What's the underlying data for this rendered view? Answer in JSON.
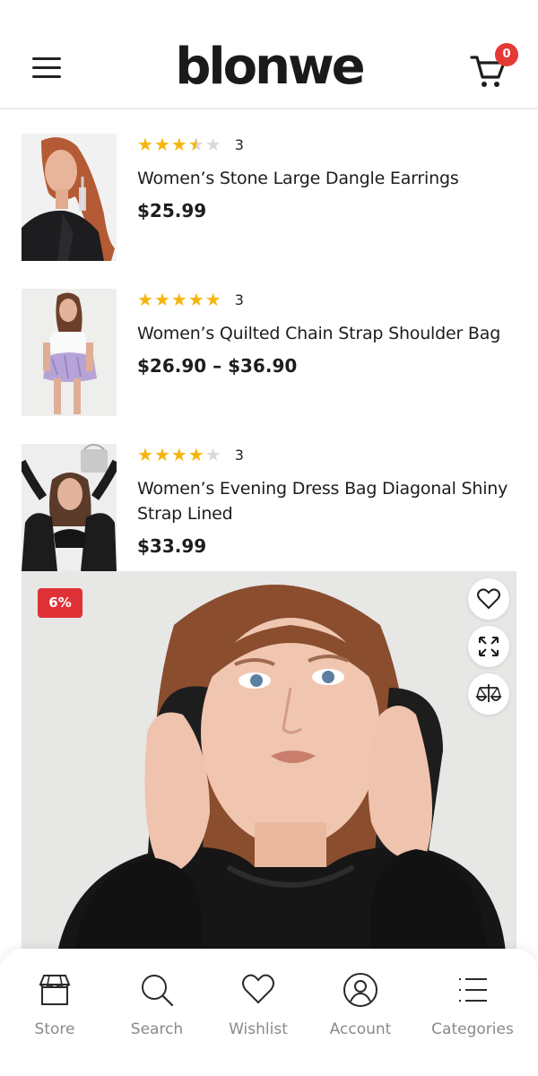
{
  "header": {
    "logo": "blonwe",
    "cart_count": "0"
  },
  "products": [
    {
      "rating": 3.5,
      "review_count": "3",
      "title": "Women’s Stone Large Dangle Earrings",
      "price": "$25.99"
    },
    {
      "rating": 5,
      "review_count": "3",
      "title": "Women’s Quilted Chain Strap Shoulder Bag",
      "price": "$26.90  –  $36.90"
    },
    {
      "rating": 4,
      "review_count": "3",
      "title": "Women’s Evening Dress Bag Diagonal Shiny Strap Lined",
      "price": "$33.99"
    }
  ],
  "hero": {
    "discount": "6%"
  },
  "nav": {
    "store": "Store",
    "search": "Search",
    "wishlist": "Wishlist",
    "account": "Account",
    "categories": "Categories"
  },
  "colors": {
    "accent": "#e53935",
    "star": "#f6b50c"
  }
}
